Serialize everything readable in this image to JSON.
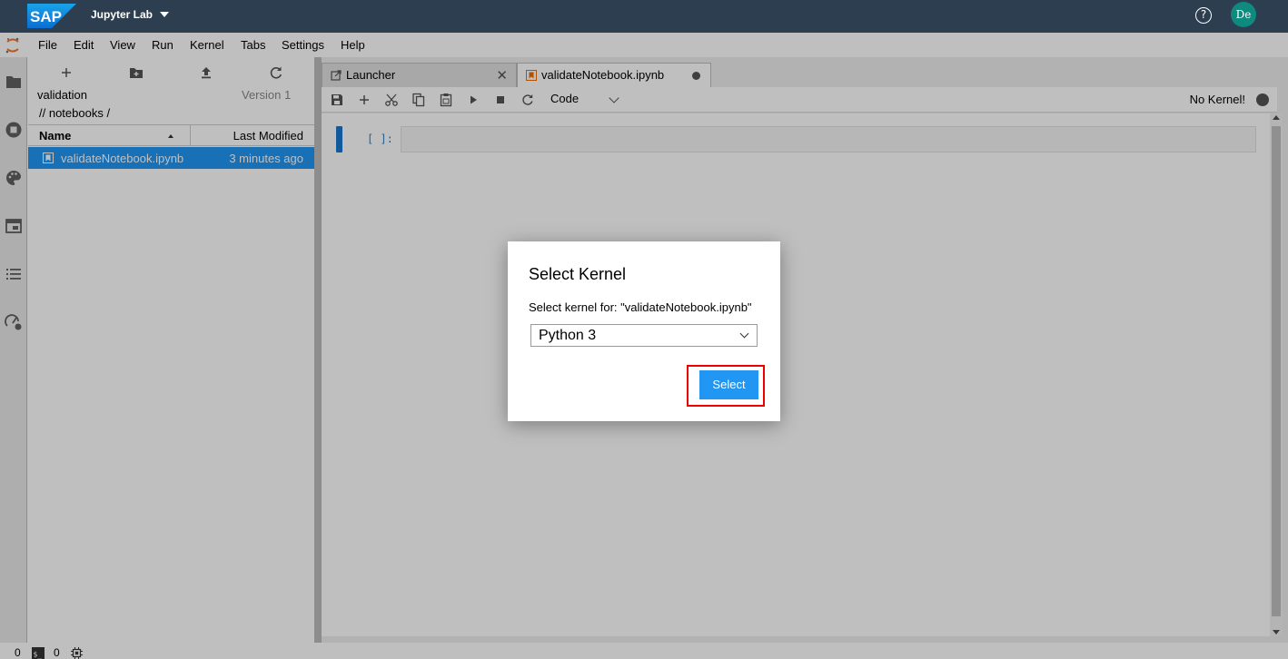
{
  "shell": {
    "logo_text": "SAP",
    "app_title": "Jupyter Lab",
    "help_symbol": "?",
    "avatar_initials": "De"
  },
  "menu": {
    "items": [
      "File",
      "Edit",
      "View",
      "Run",
      "Kernel",
      "Tabs",
      "Settings",
      "Help"
    ]
  },
  "sidebar_icons": [
    "folder-icon",
    "running-icon",
    "palette-icon",
    "tabs-icon",
    "toc-icon",
    "extension-icon"
  ],
  "file_browser": {
    "path_name": "validation",
    "version": "Version 1",
    "breadcrumb": "// notebooks /",
    "columns": {
      "name": "Name",
      "modified": "Last Modified"
    },
    "files": [
      {
        "name": "validateNotebook.ipynb",
        "modified": "3 minutes ago"
      }
    ]
  },
  "tabs": {
    "launcher": "Launcher",
    "close_symbol": "✕",
    "notebook": "validateNotebook.ipynb"
  },
  "notebook_toolbar": {
    "cell_type": "Code",
    "kernel_status": "No Kernel!"
  },
  "cell": {
    "prompt": "[ ]:"
  },
  "status_bar": {
    "terminals": "0",
    "kernels": "0"
  },
  "dialog": {
    "title": "Select Kernel",
    "message": "Select kernel for: \"validateNotebook.ipynb\"",
    "selected_kernel": "Python 3",
    "select_button": "Select"
  },
  "colors": {
    "shell_bg": "#2c3e50",
    "accent": "#2196f3",
    "highlight": "#e00000"
  }
}
